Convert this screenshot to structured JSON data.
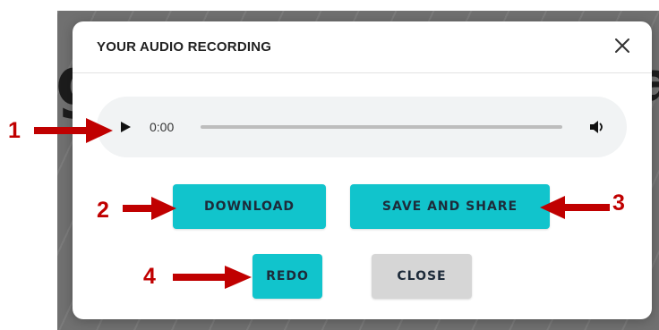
{
  "dialog": {
    "title": "YOUR AUDIO RECORDING",
    "close_icon": "close-x-icon"
  },
  "player": {
    "time": "0:00",
    "progress": 0,
    "play_icon": "play-icon",
    "volume_icon": "volume-icon"
  },
  "buttons": {
    "download": "DOWNLOAD",
    "save_and_share": "SAVE AND SHARE",
    "redo": "REDO",
    "close": "CLOSE"
  },
  "annotations": [
    "1",
    "2",
    "3",
    "4"
  ],
  "colors": {
    "accent": "#11c4cc",
    "secondary_button": "#d6d6d6",
    "annotation": "#c00000",
    "backdrop": "#707070"
  }
}
